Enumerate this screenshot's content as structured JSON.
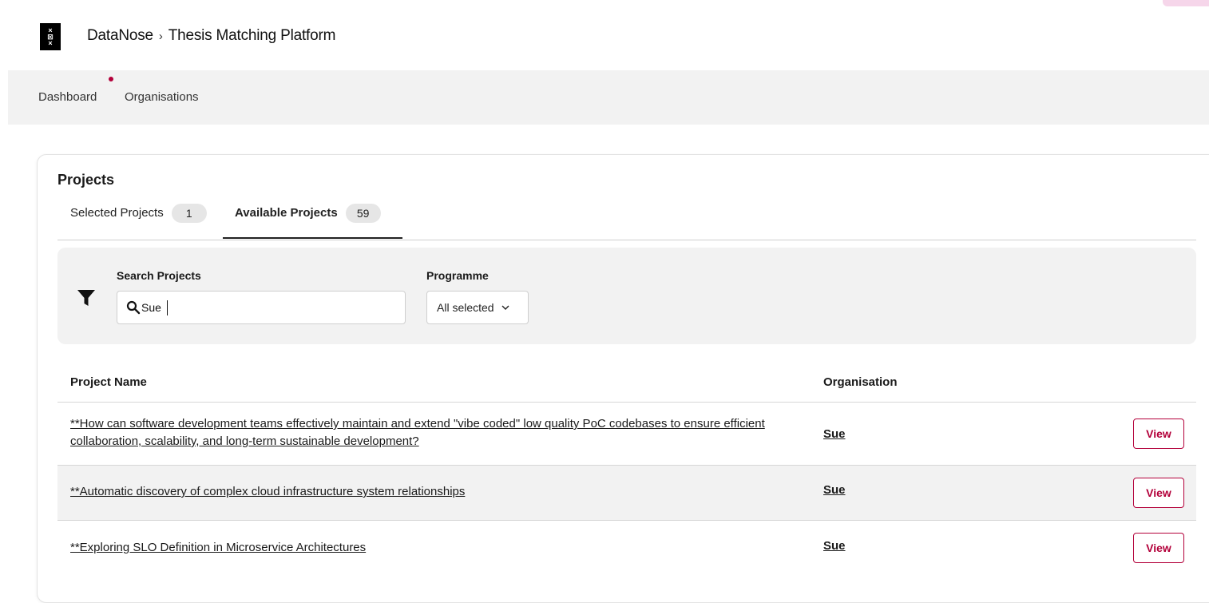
{
  "header": {
    "logo_icon": "uva-crest-icon",
    "breadcrumb_home": "DataNose",
    "breadcrumb_separator": "›",
    "breadcrumb_current": "Thesis Matching Platform"
  },
  "nav": {
    "items": [
      {
        "label": "Dashboard",
        "has_notification": true
      },
      {
        "label": "Organisations"
      }
    ]
  },
  "projects": {
    "title": "Projects",
    "tabs": [
      {
        "label": "Selected Projects",
        "count": "1",
        "active": false
      },
      {
        "label": "Available Projects",
        "count": "59",
        "active": true
      }
    ],
    "filter": {
      "icon": "filter-icon",
      "search_label": "Search Projects",
      "search_value": "Sue",
      "programme_label": "Programme",
      "programme_value": "All selected"
    },
    "table": {
      "columns": [
        "Project Name",
        "Organisation"
      ],
      "rows": [
        {
          "name": "**How can software development teams effectively maintain and extend \"vibe coded\" low quality PoC codebases to ensure efficient collaboration, scalability, and long-term sustainable development?",
          "organisation": "Sue",
          "action": "View"
        },
        {
          "name": "**Automatic discovery of complex cloud infrastructure system relationships",
          "organisation": "Sue",
          "action": "View"
        },
        {
          "name": "**Exploring SLO Definition in Microservice Architectures",
          "organisation": "Sue",
          "action": "View"
        }
      ]
    }
  },
  "colors": {
    "accent": "#b3003a",
    "panel_bg": "#f2f2f2",
    "badge_bg": "#e6e6e6"
  }
}
